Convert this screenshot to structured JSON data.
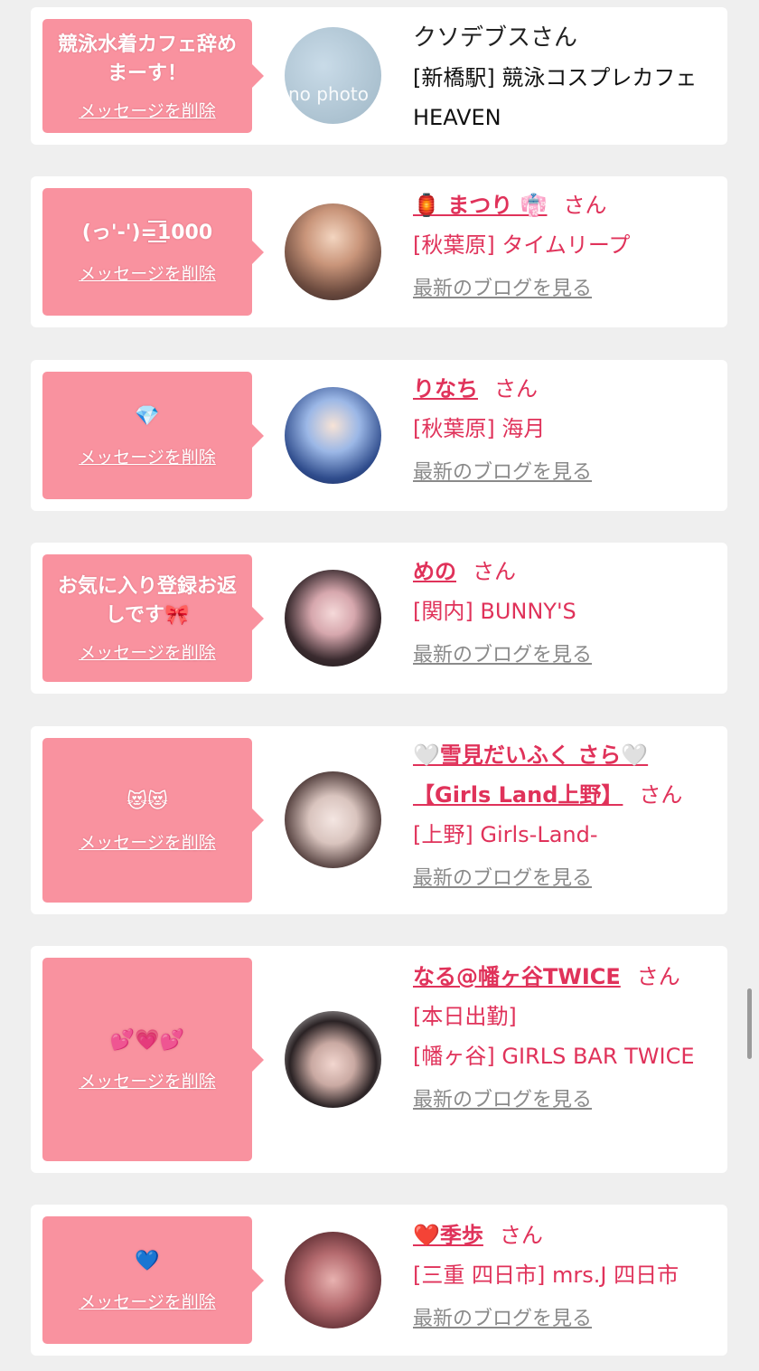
{
  "common": {
    "delete_label": "メッセージを削除",
    "blog_label": "最新のブログを見る",
    "san": "さん"
  },
  "items": [
    {
      "message": "競泳水着カフェ辞めまーす！",
      "name": "クソデブスさん",
      "shop": "[新橋駅] 競泳コスプレカフェ　HEAVEN",
      "avatar_text": "no photo"
    },
    {
      "message": "(っ'-')=͟͟͞͞1000",
      "name": "🏮 まつり 👘",
      "shop": "[秋葉原] タイムリープ"
    },
    {
      "message": "💎",
      "name": "りなち",
      "shop": "[秋葉原] 海月"
    },
    {
      "message": "お気に入り登録お返しです🎀",
      "name": "めの",
      "shop": "[関内] BUNNY'S"
    },
    {
      "message": "😻😻",
      "name": "🤍雪見だいふく さら🤍 【Girls Land上野】",
      "shop": "[上野] Girls-Land-"
    },
    {
      "message": "💕💗💕",
      "name": "なる@幡ヶ谷TWICE",
      "status": "[本日出勤]",
      "shop": "[幡ヶ谷] GIRLS BAR TWICE"
    },
    {
      "message": "💙",
      "name": "❤️季歩",
      "shop": "[三重 四日市] mrs.J 四日市"
    }
  ],
  "colors": {
    "background": "#efefef",
    "card": "#ffffff",
    "bubble": "#f9929f",
    "accent_text": "#e0325a",
    "link_gray": "#8a8a8a"
  }
}
